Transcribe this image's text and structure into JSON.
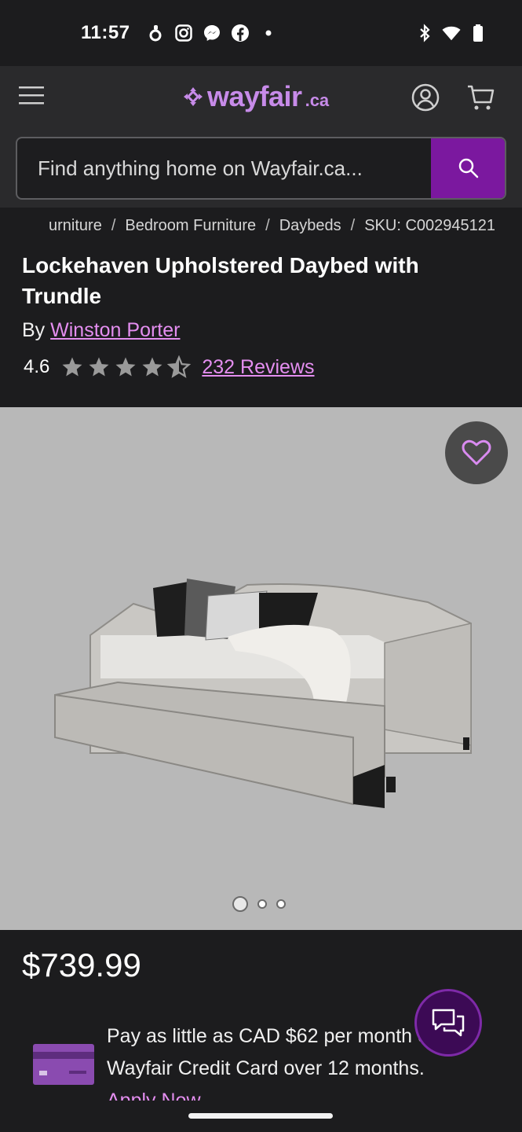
{
  "status_bar": {
    "time": "11:57"
  },
  "header": {
    "logo_text": "wayfair",
    "logo_suffix": ".ca",
    "search_placeholder": "Find anything home on Wayfair.ca..."
  },
  "breadcrumb": {
    "items": [
      "urniture",
      "Bedroom Furniture",
      "Daybeds",
      "SKU: C002945121"
    ],
    "separator": "/"
  },
  "product": {
    "title": "Lockehaven Upholstered Daybed with Trundle",
    "by_label": "By",
    "brand": "Winston Porter",
    "rating_value": "4.6",
    "rating_stars": 4.6,
    "reviews_link": "232 Reviews",
    "price": "$739.99"
  },
  "gallery": {
    "image_count": 3,
    "active_index": 0
  },
  "credit_offer": {
    "text": "Pay as little as CAD $62 per month on the Wayfair Credit Card over 12 months.",
    "apply_link": "Apply Now"
  },
  "colors": {
    "accent": "#7b189f",
    "link": "#e48ef0",
    "logo": "#c78be9",
    "background": "#1c1c1e"
  }
}
